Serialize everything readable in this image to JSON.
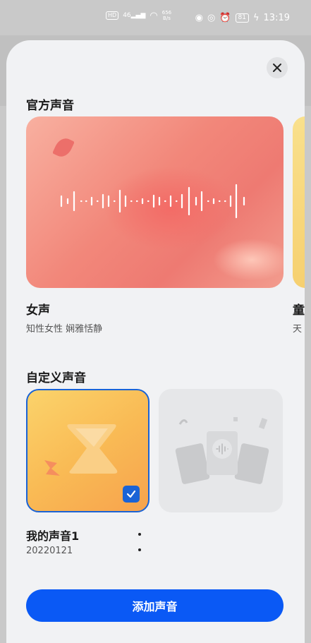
{
  "status_bar": {
    "network_chip": "HD",
    "signal_label": "46",
    "speed_value": "656",
    "speed_unit": "B/s",
    "battery": "81",
    "time": "13:19"
  },
  "sheet": {
    "official_section_title": "官方声音",
    "official_voice": {
      "name": "女声",
      "description": "知性女性 娴雅恬静"
    },
    "next_voice": {
      "name": "童",
      "description": "天"
    },
    "custom_section_title": "自定义声音",
    "custom_voice": {
      "name": "我的声音1",
      "date": "20220121",
      "selected": true
    },
    "add_button_label": "添加声音"
  },
  "colors": {
    "accent": "#0a59f5",
    "selected_border": "#1a63d6",
    "sheet_bg": "#f1f2f4"
  },
  "icons": [
    "close-icon",
    "checkmark-icon",
    "more-vertical-icon",
    "waveform-icon"
  ]
}
